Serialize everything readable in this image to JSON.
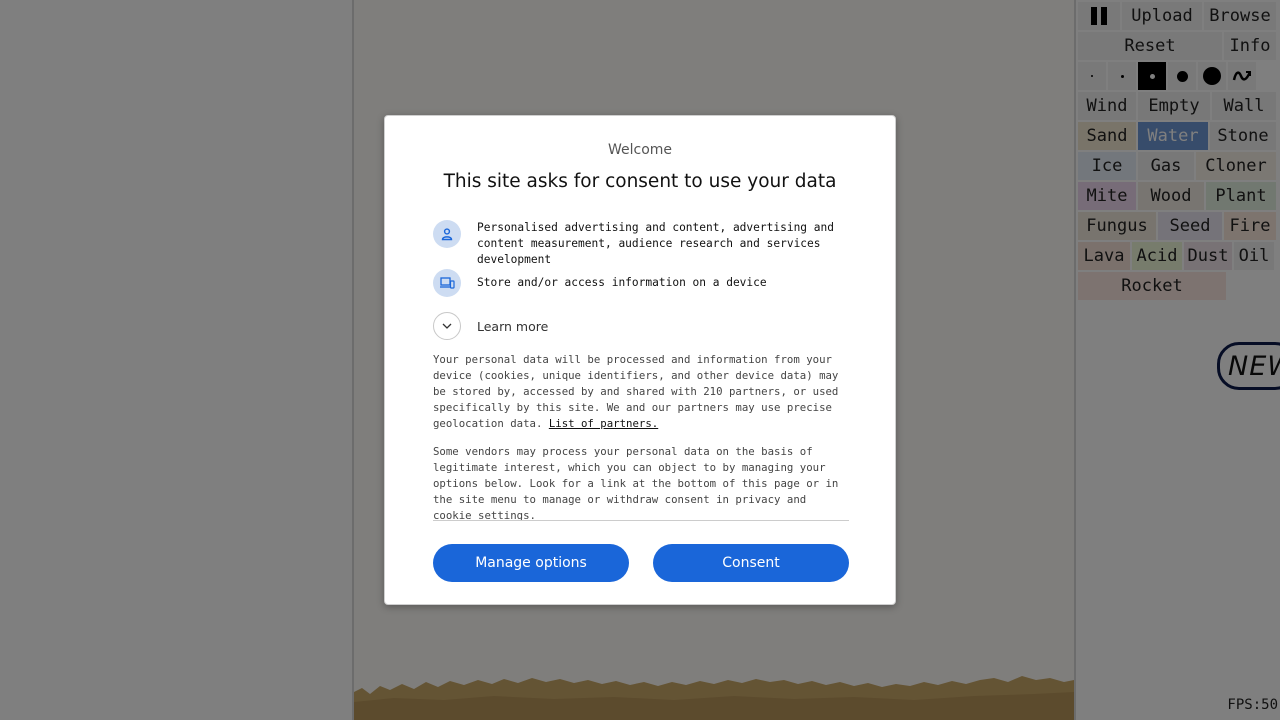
{
  "panel": {
    "top_row": [
      "Upload",
      "Browse"
    ],
    "reset_label": "Reset",
    "info_label": "Info",
    "brush_sizes": [
      {
        "name": "size-1",
        "selected": false
      },
      {
        "name": "size-2",
        "selected": false
      },
      {
        "name": "size-3",
        "selected": true
      },
      {
        "name": "size-4",
        "selected": false
      },
      {
        "name": "size-5",
        "selected": false
      }
    ],
    "elements": [
      [
        {
          "label": "Wind",
          "color": "#f0f0f0"
        },
        {
          "label": "Empty",
          "color": "#f0f0f0"
        },
        {
          "label": "Wall",
          "color": "#f0f0f0"
        }
      ],
      [
        {
          "label": "Sand",
          "color": "#f3e9d2"
        },
        {
          "label": "Water",
          "color": "#6f98d6",
          "selected": true
        },
        {
          "label": "Stone",
          "color": "#f0f0f0"
        }
      ],
      [
        {
          "label": "Ice",
          "color": "#e6eef8"
        },
        {
          "label": "Gas",
          "color": "#f0f0f0"
        },
        {
          "label": "Cloner",
          "color": "#f6f0e6"
        }
      ],
      [
        {
          "label": "Mite",
          "color": "#efd8f0"
        },
        {
          "label": "Wood",
          "color": "#f0ebe2"
        },
        {
          "label": "Plant",
          "color": "#e2f0e0"
        }
      ],
      [
        {
          "label": "Fungus",
          "color": "#f0e8dc"
        },
        {
          "label": "Seed",
          "color": "#ebe6f2"
        },
        {
          "label": "Fire",
          "color": "#fbe8dc"
        }
      ],
      [
        {
          "label": "Lava",
          "color": "#f6e2d8"
        },
        {
          "label": "Acid",
          "color": "#eef8d8"
        },
        {
          "label": "Dust",
          "color": "#f0e4ea"
        },
        {
          "label": "Oil",
          "color": "#f0f0f0"
        }
      ],
      [
        {
          "label": "Rocket",
          "color": "#fbe6e0"
        }
      ]
    ],
    "new_badge": "NEW",
    "fps": "FPS:50"
  },
  "dialog": {
    "welcome": "Welcome",
    "heading": "This site asks for consent to use your data",
    "purposes": [
      {
        "icon": "person-icon",
        "text": "Personalised advertising and content, advertising and content measurement, audience research and services development"
      },
      {
        "icon": "devices-icon",
        "text": "Store and/or access information on a device"
      }
    ],
    "learn_more": "Learn more",
    "para1": "Your personal data will be processed and information from your device (cookies, unique identifiers, and other device data) may be stored by, accessed by and shared with 210 partners, or used specifically by this site. We and our partners may use precise geolocation data.",
    "para1_link": "List of partners.",
    "para2": "Some vendors may process your personal data on the basis of legitimate interest, which you can object to by managing your options below. Look for a link at the bottom of this page or in the site menu to manage or withdraw consent in privacy and cookie settings.",
    "manage_label": "Manage options",
    "consent_label": "Consent",
    "accent_color": "#1a66d9"
  }
}
